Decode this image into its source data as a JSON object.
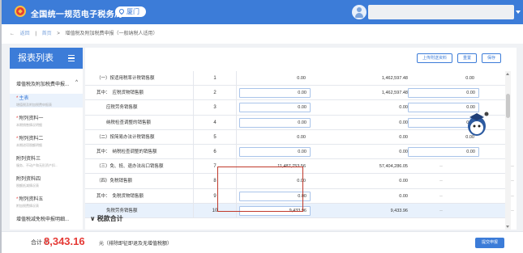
{
  "header": {
    "title": "全国统一规范电子税务局",
    "city": "厦门",
    "user": ""
  },
  "breadcrumb": {
    "back": "返回",
    "home": "首页",
    "current": "增值税及附加税费申报（一般纳税人适用）"
  },
  "sidebar": {
    "title": "报表列表",
    "group": "增值税及附加税费申报...",
    "items": [
      {
        "title": "主表",
        "sub": "增值税及附加税费申报表",
        "required": true,
        "active": true
      },
      {
        "title": "附列资料一",
        "sub": "本期销售情况明细",
        "required": true
      },
      {
        "title": "附列资料二",
        "sub": "本期进项税额明细",
        "required": true
      },
      {
        "title": "附列资料三",
        "sub": "服务、不动产和无形资产扣...",
        "required": false
      },
      {
        "title": "附列资料四",
        "sub": "税额抵减情况表",
        "required": false
      },
      {
        "title": "附列资料五",
        "sub": "附加税费情况表",
        "required": true
      },
      {
        "title": "增值税减免税申报明细...",
        "sub": "",
        "required": false
      }
    ]
  },
  "toolbar": {
    "upload": "上传附送资料",
    "reset": "重置",
    "save": "保存"
  },
  "table": {
    "rows": [
      {
        "label": "（一）按适用税率计税销售额",
        "pre": "",
        "num": "1",
        "c1": "0.00",
        "c2": "1,462,597.48",
        "c3": "0.00",
        "c4": "0.00",
        "input1": false,
        "input3": false
      },
      {
        "label": "应税货物销售额",
        "pre": "其中：",
        "num": "2",
        "c1": "0.00",
        "c2": "1,462,597.48",
        "c3": "0.00",
        "c4": "0.00",
        "input1": true,
        "input3": true
      },
      {
        "label": "应税劳务销售额",
        "pre": "",
        "num": "3",
        "c1": "0.00",
        "c2": "0.00",
        "c3": "0.00",
        "c4": "0.00",
        "input1": true,
        "input3": true
      },
      {
        "label": "纳税检查调整的销售额",
        "pre": "",
        "num": "4",
        "c1": "0.00",
        "c2": "0.00",
        "c3": "0.00",
        "c4": "0.00",
        "input1": true,
        "input3": true
      },
      {
        "label": "（二）按简易办法计税销售额",
        "pre": "",
        "num": "5",
        "c1": "0.00",
        "c2": "0.00",
        "c3": "0.00",
        "c4": "0.00",
        "input1": false,
        "input3": false
      },
      {
        "label": "纳税检查调整的销售额",
        "pre": "其中：",
        "num": "6",
        "c1": "0.00",
        "c2": "0.00",
        "c3": "0.00",
        "c4": "0.00",
        "input1": true,
        "input3": true
      },
      {
        "label": "（三）免、抵、退办法出口销售额",
        "pre": "",
        "num": "7",
        "c1": "11,487,753.56",
        "c2": "57,404,286.05",
        "c3": "--",
        "c4": "--",
        "input1": false,
        "input3": false
      },
      {
        "label": "（四）免税销售额",
        "pre": "",
        "num": "8",
        "c1": "0.00",
        "c2": "0.00",
        "c3": "--",
        "c4": "--",
        "input1": false,
        "input3": false
      },
      {
        "label": "免税货物销售额",
        "pre": "其中：",
        "num": "9",
        "c1": "0.00",
        "c2": "0.00",
        "c3": "--",
        "c4": "--",
        "input1": true,
        "input3": false
      },
      {
        "label": "免税劳务销售额",
        "pre": "",
        "num": "10",
        "c1": "9,433.96",
        "c2": "9,433.96",
        "c3": "--",
        "c4": "--",
        "input1": true,
        "input3": false,
        "highlight": true
      }
    ],
    "section": "税款合计"
  },
  "footer": {
    "label": "合计 ⓘ",
    "amount": "8,343.16",
    "unit": "元（排除即征即退及无增值税额）",
    "submit": "提交申报"
  }
}
